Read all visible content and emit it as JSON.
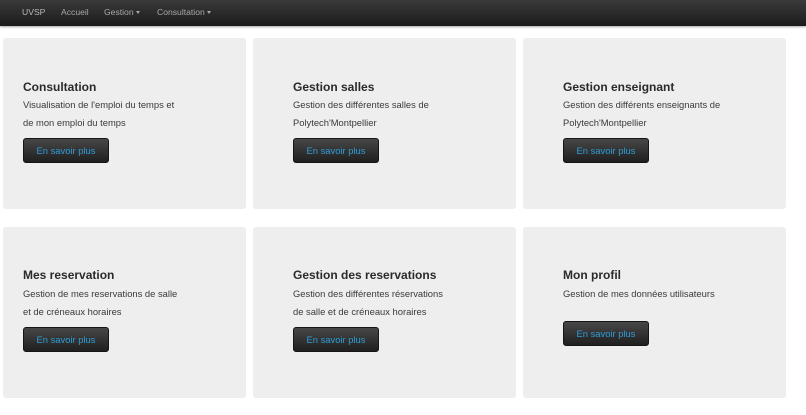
{
  "navbar": {
    "brand": "UVSP",
    "items": [
      {
        "label": "Accueil",
        "dropdown": false
      },
      {
        "label": "Gestion",
        "dropdown": true
      },
      {
        "label": "Consultation",
        "dropdown": true
      }
    ]
  },
  "cards": [
    {
      "title": "Consultation",
      "description": "Visualisation de l'emploi du temps et\nde mon emploi du temps",
      "button": "En savoir plus"
    },
    {
      "title": "Gestion salles",
      "description": "Gestion des différentes salles de\nPolytech'Montpellier",
      "button": "En savoir plus"
    },
    {
      "title": "Gestion enseignant",
      "description": "Gestion des différents enseignants de\nPolytech'Montpellier",
      "button": "En savoir plus"
    },
    {
      "title": "Mes reservation",
      "description": "Gestion de mes reservations de salle\net de créneaux horaires",
      "button": "En savoir plus"
    },
    {
      "title": "Gestion des reservations",
      "description": "Gestion des différentes réservations\nde salle et de créneaux horaires",
      "button": "En savoir plus"
    },
    {
      "title": "Mon profil",
      "description": "Gestion de mes données utilisateurs",
      "button": "En savoir plus"
    }
  ],
  "colors": {
    "navbar_bg": "#222222",
    "card_bg": "#eeeeee",
    "button_text": "#2e9dd8"
  }
}
